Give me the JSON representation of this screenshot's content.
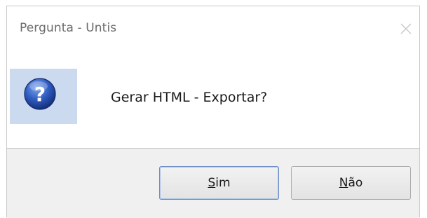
{
  "window": {
    "title": "Pergunta - Untis",
    "close_icon": "close-icon"
  },
  "dialog": {
    "icon": "question-icon",
    "message": "Gerar HTML - Exportar?"
  },
  "buttons": {
    "yes": {
      "mnemonic": "S",
      "rest": "im"
    },
    "no": {
      "mnemonic": "N",
      "rest": "ão"
    }
  },
  "colors": {
    "icon_background": "#ccdaf0",
    "icon_blue": "#2a55b8",
    "footer_background": "#f0f0f0"
  }
}
